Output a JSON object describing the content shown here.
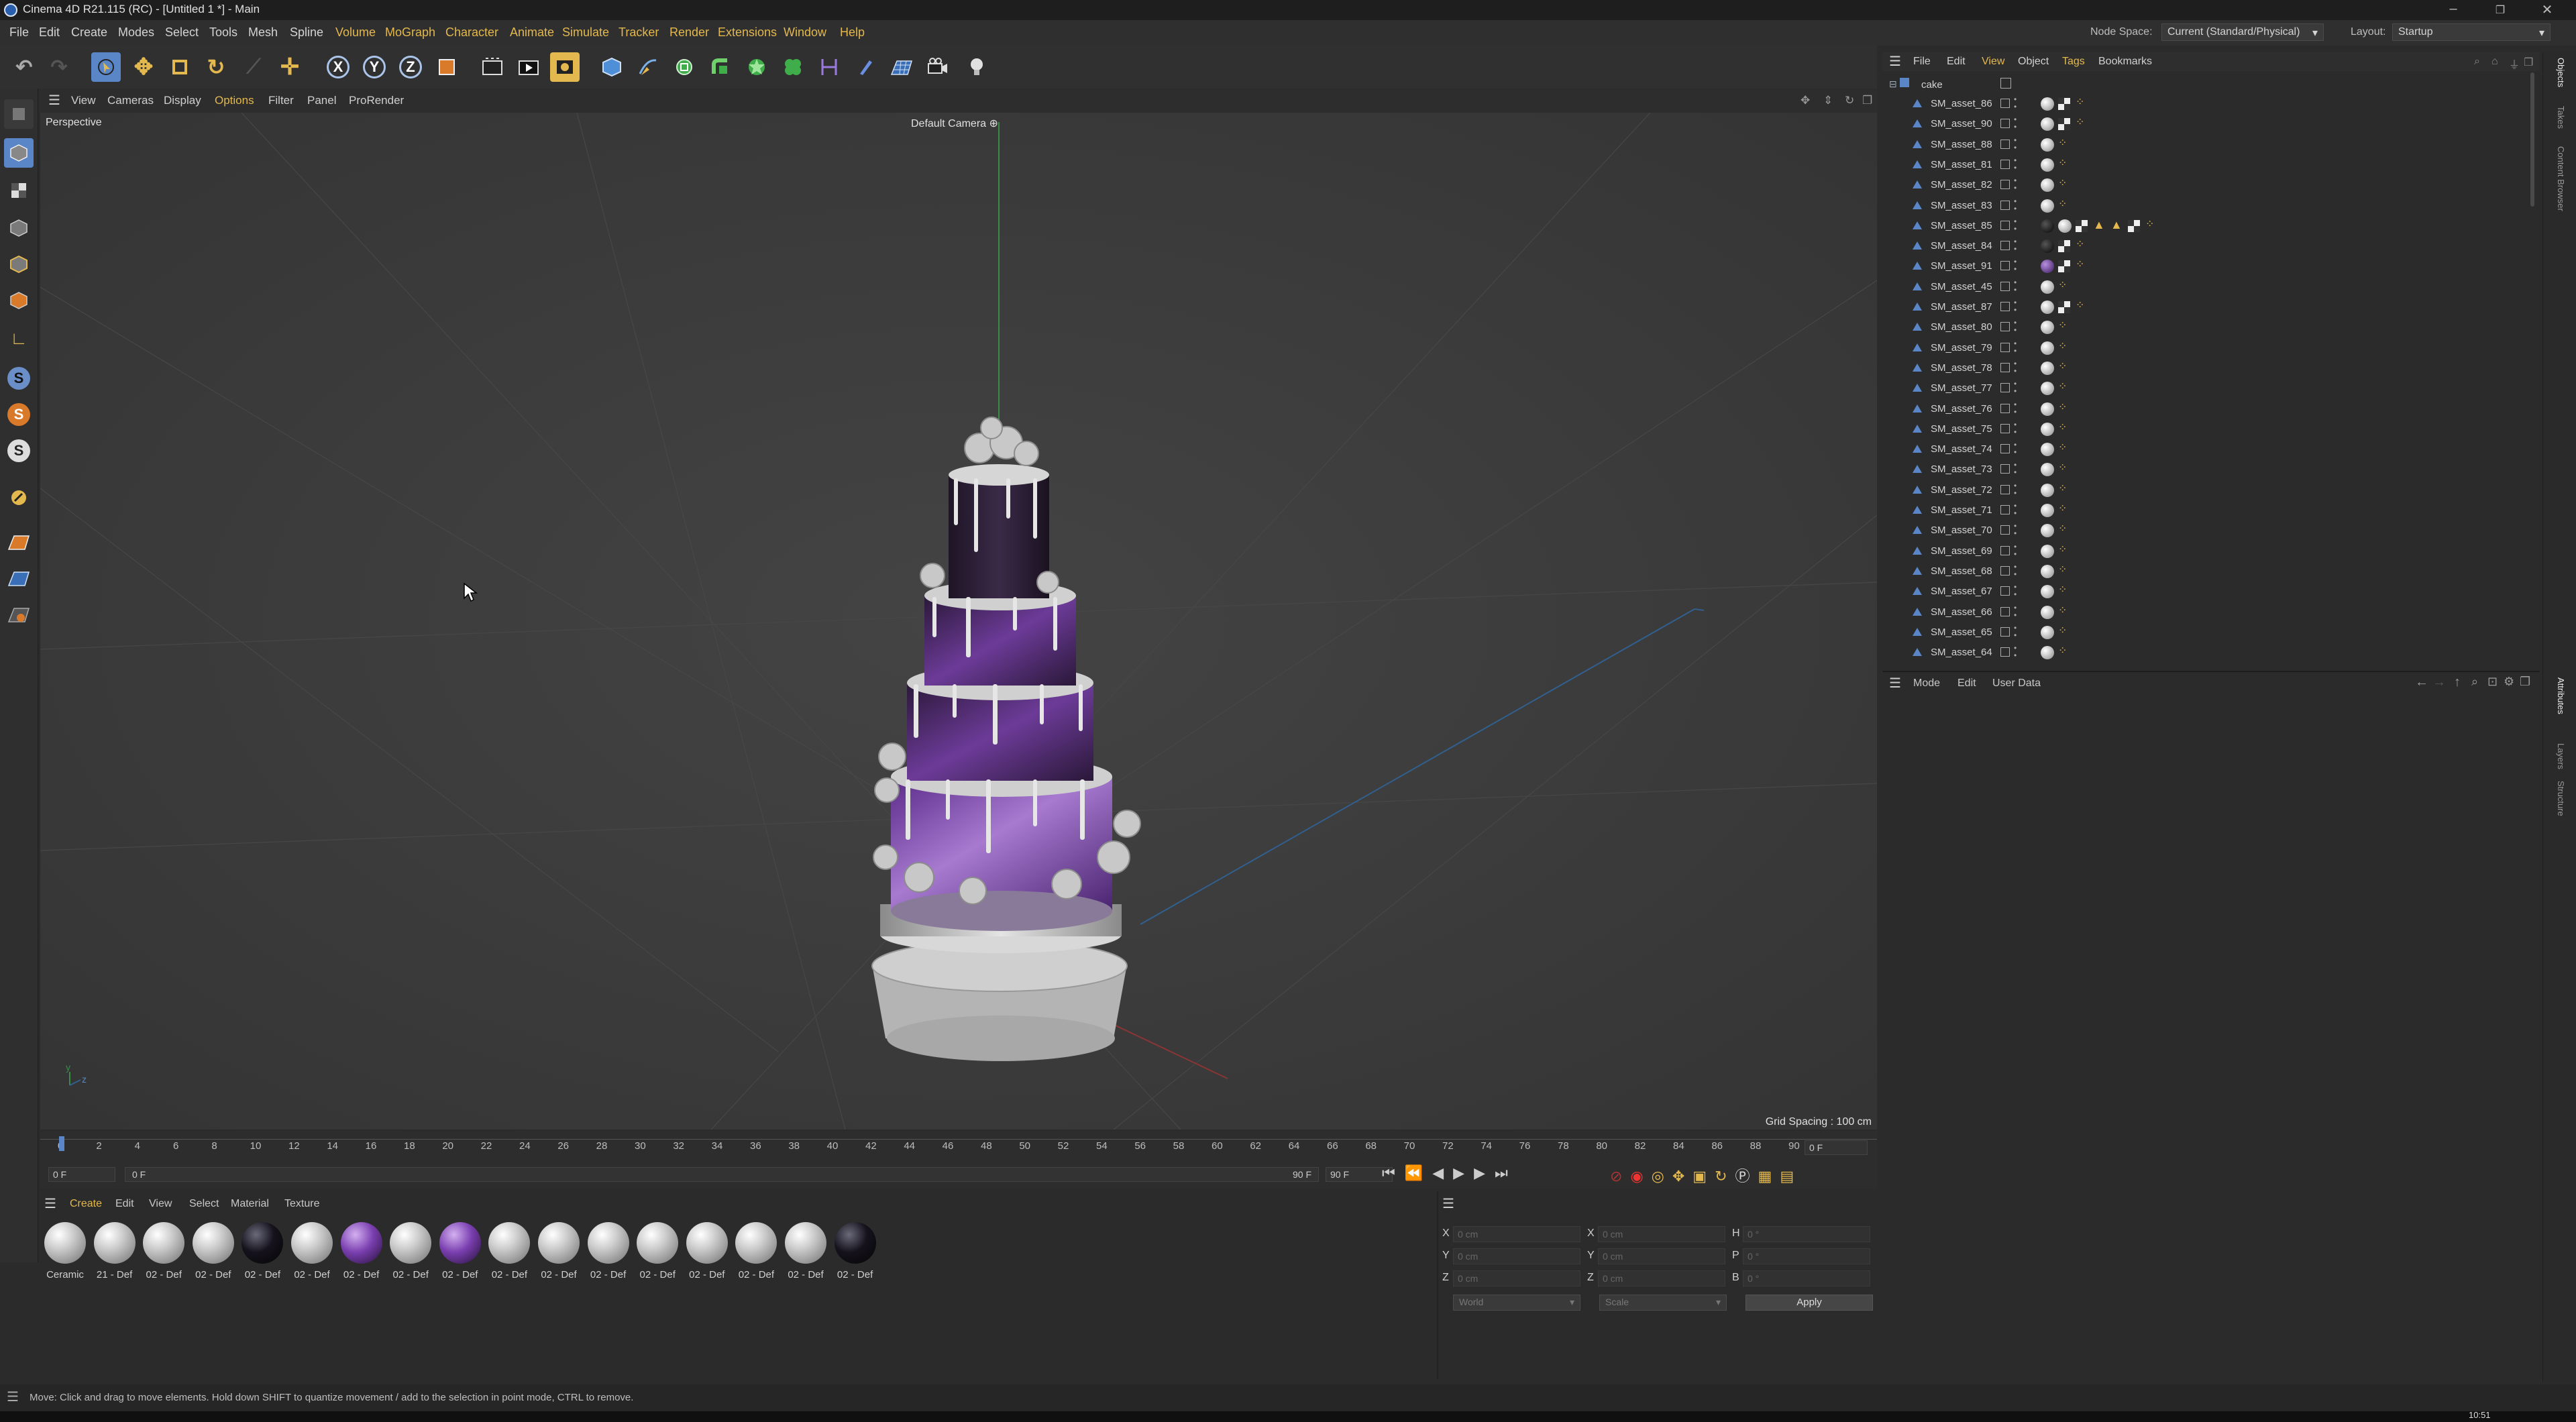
{
  "app": {
    "window_title": "Cinema 4D R21.115 (RC) - [Untitled 1 *] - Main",
    "node_space_label": "Node Space:",
    "node_space_value": "Current (Standard/Physical)",
    "layout_label": "Layout:",
    "layout_value": "Startup"
  },
  "menubar": [
    "File",
    "Edit",
    "Create",
    "Modes",
    "Select",
    "Tools",
    "Mesh",
    "Spline",
    "Volume",
    "MoGraph",
    "Character",
    "Animate",
    "Simulate",
    "Tracker",
    "Render",
    "Extensions",
    "Window",
    "Help"
  ],
  "viewport": {
    "menu": [
      "View",
      "Cameras",
      "Display",
      "Options",
      "Filter",
      "Panel",
      "ProRender"
    ],
    "projection": "Perspective",
    "camera": "Default Camera",
    "grid_spacing": "Grid Spacing : 100 cm"
  },
  "object_manager": {
    "menu": [
      "File",
      "Edit",
      "View",
      "Object",
      "Tags",
      "Bookmarks"
    ],
    "root": "cake",
    "objects": [
      "SM_asset_86",
      "SM_asset_90",
      "SM_asset_88",
      "SM_asset_81",
      "SM_asset_82",
      "SM_asset_83",
      "SM_asset_85",
      "SM_asset_84",
      "SM_asset_91",
      "SM_asset_45",
      "SM_asset_87",
      "SM_asset_80",
      "SM_asset_79",
      "SM_asset_78",
      "SM_asset_77",
      "SM_asset_76",
      "SM_asset_75",
      "SM_asset_74",
      "SM_asset_73",
      "SM_asset_72",
      "SM_asset_71",
      "SM_asset_70",
      "SM_asset_69",
      "SM_asset_68",
      "SM_asset_67",
      "SM_asset_66",
      "SM_asset_65",
      "SM_asset_64"
    ]
  },
  "attribute_manager": {
    "menu": [
      "Mode",
      "Edit",
      "User Data"
    ]
  },
  "right_tabs": [
    "Objects",
    "Takes",
    "Content Browser",
    "Attributes",
    "Layers",
    "Structure"
  ],
  "timeline": {
    "ticks": [
      "0",
      "2",
      "4",
      "6",
      "8",
      "10",
      "12",
      "14",
      "16",
      "18",
      "20",
      "22",
      "24",
      "26",
      "28",
      "30",
      "32",
      "34",
      "36",
      "38",
      "40",
      "42",
      "44",
      "46",
      "48",
      "50",
      "52",
      "54",
      "56",
      "58",
      "60",
      "62",
      "64",
      "66",
      "68",
      "70",
      "72",
      "74",
      "76",
      "78",
      "80",
      "82",
      "84",
      "86",
      "88",
      "90"
    ],
    "current_frame": "0 F",
    "start_field": "0 F",
    "start_preview": "0 F",
    "end_preview": "90 F",
    "end_field": "90 F"
  },
  "material_manager": {
    "menu": [
      "Create",
      "Edit",
      "View",
      "Select",
      "Material",
      "Texture"
    ],
    "materials": [
      {
        "name": "Ceramic",
        "color": "silver"
      },
      {
        "name": "21 - Def",
        "color": "silver"
      },
      {
        "name": "02 - Def",
        "color": "silver"
      },
      {
        "name": "02 - Def",
        "color": "silver"
      },
      {
        "name": "02 - Def",
        "color": "black"
      },
      {
        "name": "02 - Def",
        "color": "silver"
      },
      {
        "name": "02 - Def",
        "color": "purple"
      },
      {
        "name": "02 - Def",
        "color": "silver"
      },
      {
        "name": "02 - Def",
        "color": "purple"
      },
      {
        "name": "02 - Def",
        "color": "silver"
      },
      {
        "name": "02 - Def",
        "color": "silver"
      },
      {
        "name": "02 - Def",
        "color": "silver"
      },
      {
        "name": "02 - Def",
        "color": "silver"
      },
      {
        "name": "02 - Def",
        "color": "silver"
      },
      {
        "name": "02 - Def",
        "color": "silver"
      },
      {
        "name": "02 - Def",
        "color": "silver"
      },
      {
        "name": "02 - Def",
        "color": "black"
      }
    ]
  },
  "coordinates": {
    "rows": [
      {
        "pos_label": "X",
        "pos": "0 cm",
        "size_label": "X",
        "size": "0 cm",
        "rot_label": "H",
        "rot": "0 °"
      },
      {
        "pos_label": "Y",
        "pos": "0 cm",
        "size_label": "Y",
        "size": "0 cm",
        "rot_label": "P",
        "rot": "0 °"
      },
      {
        "pos_label": "Z",
        "pos": "0 cm",
        "size_label": "Z",
        "size": "0 cm",
        "rot_label": "B",
        "rot": "0 °"
      }
    ],
    "space": "World",
    "mode": "Scale",
    "apply": "Apply"
  },
  "status": "Move: Click and drag to move elements. Hold down SHIFT to quantize movement / add to the selection in point mode, CTRL to remove.",
  "clock": "10:51",
  "colors": {
    "accent": "#e3b84e",
    "selection": "#5a86c8",
    "purple": "#7a3fb0"
  }
}
